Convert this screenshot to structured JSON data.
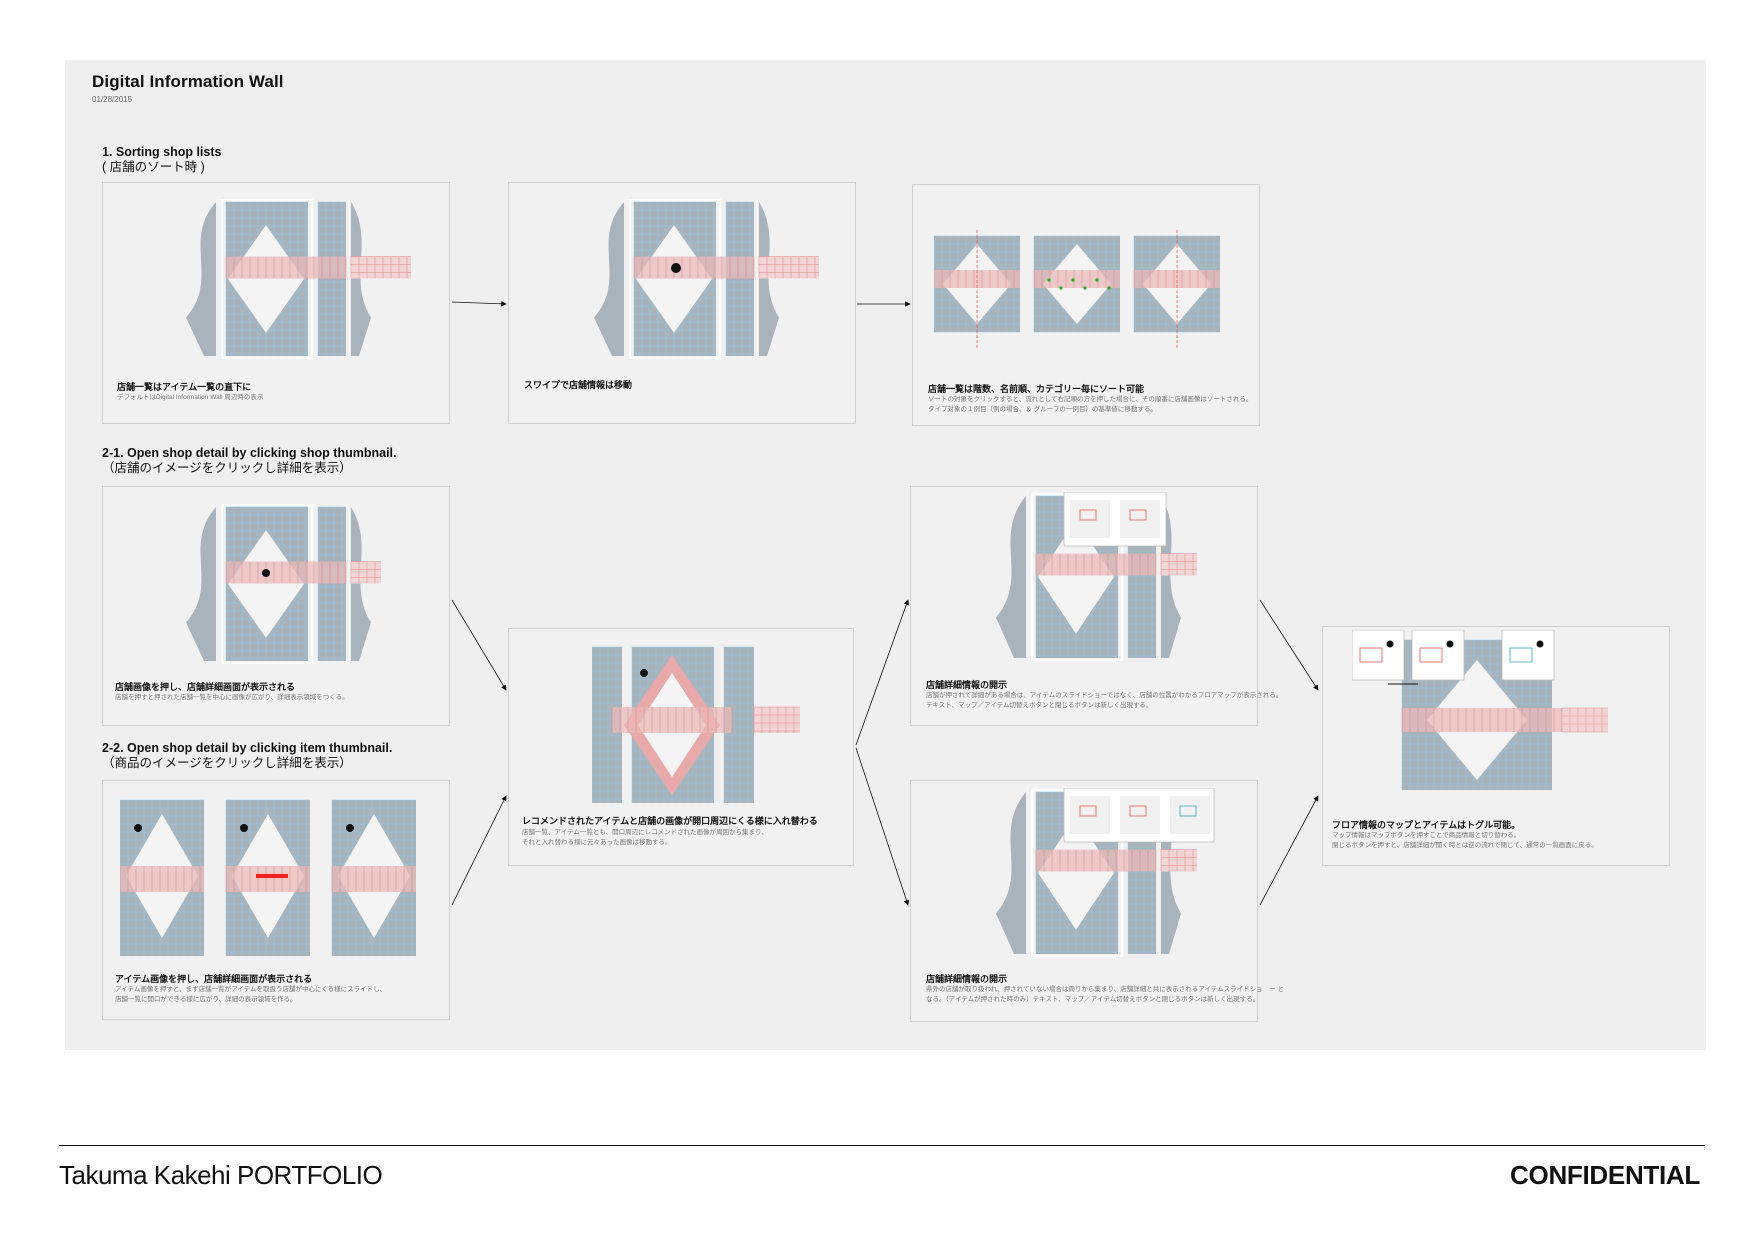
{
  "header": {
    "title": "Digital Information Wall",
    "date": "01/28/2015"
  },
  "sections": {
    "s1": {
      "en": "1. Sorting shop lists",
      "jp": "( 店舗のソート時 )"
    },
    "s21": {
      "en": "2-1. Open shop detail by clicking shop thumbnail.",
      "jp": "（店舗のイメージをクリックし詳細を表示）"
    },
    "s22": {
      "en": "2-2. Open shop detail by clicking item thumbnail.",
      "jp": "（商品のイメージをクリックし詳細を表示）"
    }
  },
  "panels": [
    {
      "caption": "店舗一覧はアイテム一覧の直下に",
      "desc": "デフォルトはDigital Information Wall 周辺時の表示"
    },
    {
      "caption": "スワイプで店舗情報は移動",
      "desc": ""
    },
    {
      "caption": "店舗一覧は階数、名前順、カテゴリー毎にソート可能",
      "desc": "ソートの対象をクリックすると、流れとして右記順の方を押した場合に、その順番に店舗画像はソートされる。\nタイプ対象の１例目（例の場合、＆ グループのー例目）の基準値に移動する。"
    },
    {
      "caption": "店舗画像を押し、店舗詳細画面が表示される",
      "desc": "店舗を押すと押された店舗一覧を中心に画像が広がり、詳細表示領域をつくる。"
    },
    {
      "caption": "アイテム画像を押し、店舗詳細画面が表示される",
      "desc": "アイテム画像を押すと、まず店舗一覧がアイテムを取扱う店舗が中心にくる様にスライドし、\n店舗一覧に開口ができる様に広がり、詳細の表示領域を作る。"
    },
    {
      "caption": "レコメンドされたアイテムと店舗の画像が開口周辺にくる様に入れ替わる",
      "desc": "店舗一覧、アイテム一覧とも、開口周辺にレコメンドされた画像が周囲から集まり、\nそれと入れ替わる様に元々あった画像は移動する。"
    },
    {
      "caption": "店舗詳細情報の開示",
      "desc": "店舗が押されて詳細がある場合は、アイテムのスライドショーではなく、店舗の位置がわかるフロアマップが表示される。\nテキスト、マップ／アイテム切替えボタンと閉じるボタンは新しく出現する。"
    },
    {
      "caption": "店舗詳細情報の開示",
      "desc": "県外の店舗が取り扱われ、押されていない場合は周りから集まり、店舗詳細と共に表示されるアイテムスライドショ　ー と\nなる。（アイテムが押された時のみ）テキスト、マップ／アイテム切替えボタンと閉じるボタンは新しく出現する。"
    },
    {
      "caption": "フロア情報のマップとアイテムはトグル可能。",
      "desc": "マップ情報はマップボタンを押すことで商品情報と切り替わる。\n閉じるボタンを押すと、店舗詳細が開く時とは逆の流れで閉じて、通常の一覧画面に戻る。"
    }
  ],
  "footer": {
    "left": "Takuma Kakehi PORTFOLIO",
    "right": "CONFIDENTIAL"
  }
}
